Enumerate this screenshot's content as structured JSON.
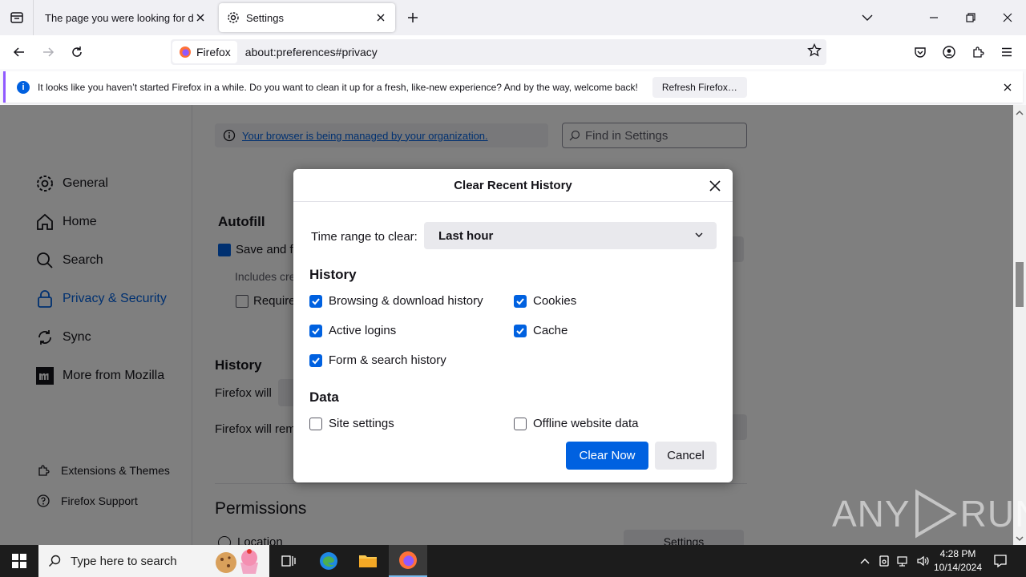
{
  "tabs": [
    {
      "title": "The page you were looking for doesn't exist"
    },
    {
      "title": "Settings"
    }
  ],
  "urlbar": {
    "identity_label": "Firefox",
    "url": "about:preferences#privacy"
  },
  "notification": {
    "message": "It looks like you haven’t started Firefox in a while. Do you want to clean it up for a fresh, like-new experience? And by the way, welcome back!",
    "button_label": "Refresh Firefox…"
  },
  "sidebar": {
    "items": [
      {
        "label": "General"
      },
      {
        "label": "Home"
      },
      {
        "label": "Search"
      },
      {
        "label": "Privacy & Security"
      },
      {
        "label": "Sync"
      },
      {
        "label": "More from Mozilla"
      }
    ],
    "footer": [
      {
        "label": "Extensions & Themes"
      },
      {
        "label": "Firefox Support"
      }
    ]
  },
  "main": {
    "managed_link": "Your browser is being managed by your organization.",
    "find_placeholder": "Find in Settings",
    "autofill_heading": "Autofill",
    "autofill_save": "Save and fi",
    "autofill_includes": "Includes cre",
    "autofill_require": "Require",
    "history_heading": "History",
    "firefox_will": "Firefox will",
    "firefox_will_remember": "Firefox will rem",
    "permissions_heading": "Permissions",
    "location_label": "Location",
    "settings_button": "Settings"
  },
  "dialog": {
    "title": "Clear Recent History",
    "time_range_label": "Time range to clear:",
    "time_range_value": "Last hour",
    "history_heading": "History",
    "history_options": [
      {
        "label": "Browsing & download history",
        "checked": true
      },
      {
        "label": "Cookies",
        "checked": true
      },
      {
        "label": "Active logins",
        "checked": true
      },
      {
        "label": "Cache",
        "checked": true
      },
      {
        "label": "Form & search history",
        "checked": true
      }
    ],
    "data_heading": "Data",
    "data_options": [
      {
        "label": "Site settings",
        "checked": false
      },
      {
        "label": "Offline website data",
        "checked": false
      }
    ],
    "clear_button": "Clear Now",
    "cancel_button": "Cancel"
  },
  "watermark": {
    "text_left": "ANY",
    "text_right": "RUN"
  },
  "taskbar": {
    "search_placeholder": "Type here to search",
    "time": "4:28 PM",
    "date": "10/14/2024"
  },
  "colors": {
    "accent": "#0061e0",
    "notification_border": "#9059ff",
    "taskbar": "#1c1c1c"
  }
}
